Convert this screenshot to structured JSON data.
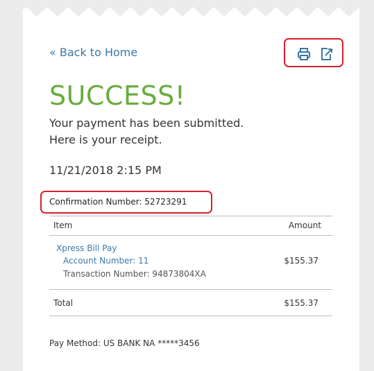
{
  "nav": {
    "back_label": "« Back to Home"
  },
  "toolbar": {
    "print_icon": "printer-icon",
    "export_icon": "export-icon"
  },
  "status": {
    "title": "SUCCESS!",
    "message_line1": "Your payment has been submitted.",
    "message_line2": "Here is your receipt.",
    "datetime": "11/21/2018 2:15 PM"
  },
  "receipt": {
    "confirmation": "Confirmation Number: 52723291",
    "columns": {
      "item": "Item",
      "amount": "Amount"
    },
    "line_item": {
      "name": "Xpress Bill Pay",
      "account": "Account Number: 11",
      "transaction": "Transaction Number: 94873804XA",
      "amount": "$155.37"
    },
    "total": {
      "label": "Total",
      "amount": "$155.37"
    },
    "pay_method": "Pay Method: US BANK NA *****3456"
  },
  "colors": {
    "accent_green": "#6aac3f",
    "link_blue": "#3a77a8",
    "highlight_red": "#d6202a"
  }
}
